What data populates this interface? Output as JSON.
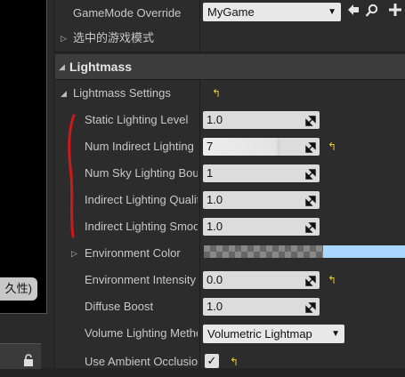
{
  "left_panel": {
    "persist_button_label": "久性)"
  },
  "world_settings": {
    "gamemode_label": "GameMode Override",
    "gamemode_value": "MyGame",
    "selected_gamemode_label": "选中的游戏模式"
  },
  "lightmass": {
    "category_label": "Lightmass",
    "settings_label": "Lightmass Settings",
    "properties": [
      {
        "label": "Static Lighting Level",
        "value": "1.0"
      },
      {
        "label": "Num Indirect Lighting Bounces",
        "value": "7"
      },
      {
        "label": "Num Sky Lighting Bounces",
        "value": "1"
      },
      {
        "label": "Indirect Lighting Quality",
        "value": "1.0"
      },
      {
        "label": "Indirect Lighting Smoothness",
        "value": "1.0"
      },
      {
        "label": "Environment Color",
        "value": ""
      },
      {
        "label": "Environment Intensity",
        "value": "0.0"
      },
      {
        "label": "Diffuse Boost",
        "value": "1.0"
      },
      {
        "label": "Volume Lighting Method",
        "value": "Volumetric Lightmap"
      },
      {
        "label": "Use Ambient Occlusion",
        "value": "✓"
      }
    ]
  },
  "colors": {
    "reset_arrow": "#e8c830",
    "environment_color": "#a8d8ff",
    "annotation_red": "#d01818"
  },
  "icons": [
    "browse-arrow-icon",
    "search-icon",
    "add-icon",
    "spin-drag-icon",
    "reset-to-default-icon",
    "lock-icon",
    "checkmark-icon"
  ]
}
